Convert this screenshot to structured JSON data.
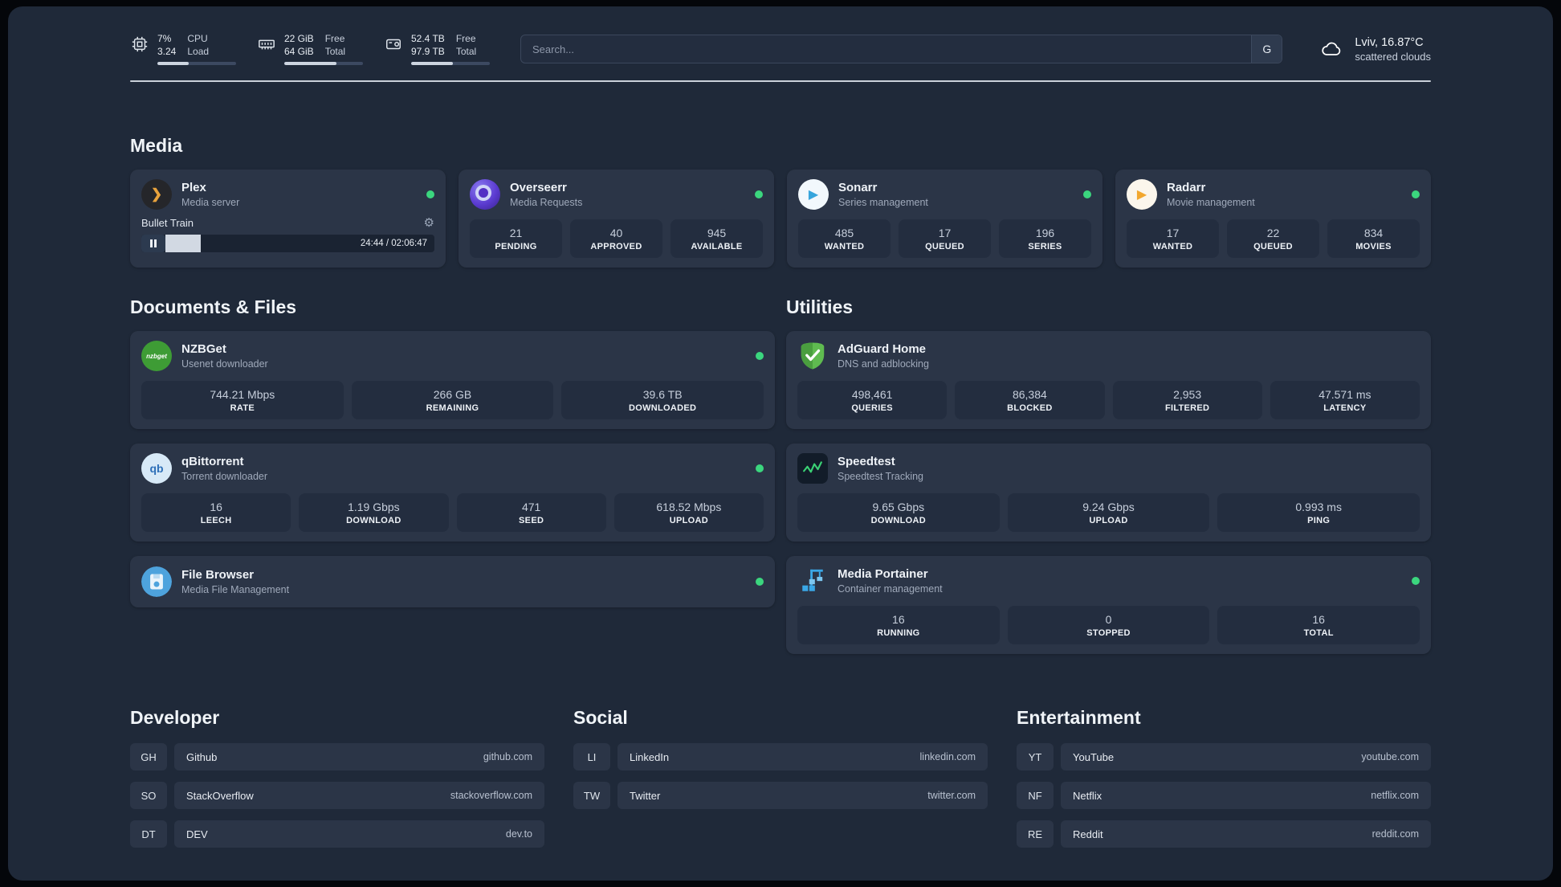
{
  "colors": {
    "status_online": "#3bd67e",
    "background": "#1f2939",
    "card": "#2b3547",
    "stat_tile": "#232d3f",
    "plex_amber": "#e8a33d",
    "overseerr_purple": "#5b3bd0",
    "sonarr_blue": "#37a5dc",
    "radarr_yellow": "#f2a72e",
    "nzbget_green": "#3e9c35",
    "adguard_green": "#5fbb50",
    "portainer_blue": "#3aa7e6"
  },
  "topbar": {
    "monitors": [
      {
        "icon": "cpu-icon",
        "line1": "7%",
        "line2": "3.24",
        "label1": "CPU",
        "label2": "Load",
        "percent": 40
      },
      {
        "icon": "memory-icon",
        "line1": "22 GiB",
        "line2": "64 GiB",
        "label1": "Free",
        "label2": "Total",
        "percent": 66
      },
      {
        "icon": "disk-icon",
        "line1": "52.4 TB",
        "line2": "97.9 TB",
        "label1": "Free",
        "label2": "Total",
        "percent": 53
      }
    ],
    "search": {
      "placeholder": "Search...",
      "engine_button": "G"
    },
    "weather": {
      "location": "Lviv, 16.87°C",
      "condition": "scattered clouds"
    }
  },
  "media": {
    "heading": "Media",
    "plex": {
      "name": "Plex",
      "subtitle": "Media server",
      "status": "online",
      "now_playing": "Bullet Train",
      "time": "24:44 / 02:06:47",
      "progress_percent": 19
    },
    "overseerr": {
      "name": "Overseerr",
      "subtitle": "Media Requests",
      "status": "online",
      "stats": [
        {
          "value": "21",
          "label": "PENDING"
        },
        {
          "value": "40",
          "label": "APPROVED"
        },
        {
          "value": "945",
          "label": "AVAILABLE"
        }
      ]
    },
    "sonarr": {
      "name": "Sonarr",
      "subtitle": "Series management",
      "status": "online",
      "stats": [
        {
          "value": "485",
          "label": "WANTED"
        },
        {
          "value": "17",
          "label": "QUEUED"
        },
        {
          "value": "196",
          "label": "SERIES"
        }
      ]
    },
    "radarr": {
      "name": "Radarr",
      "subtitle": "Movie management",
      "status": "online",
      "stats": [
        {
          "value": "17",
          "label": "WANTED"
        },
        {
          "value": "22",
          "label": "QUEUED"
        },
        {
          "value": "834",
          "label": "MOVIES"
        }
      ]
    }
  },
  "documents": {
    "heading": "Documents & Files",
    "nzbget": {
      "name": "NZBGet",
      "subtitle": "Usenet downloader",
      "status": "online",
      "icon_text": "nzbget",
      "stats": [
        {
          "value": "744.21 Mbps",
          "label": "RATE"
        },
        {
          "value": "266 GB",
          "label": "REMAINING"
        },
        {
          "value": "39.6 TB",
          "label": "DOWNLOADED"
        }
      ]
    },
    "qbittorrent": {
      "name": "qBittorrent",
      "subtitle": "Torrent downloader",
      "status": "online",
      "icon_text": "qb",
      "stats": [
        {
          "value": "16",
          "label": "LEECH"
        },
        {
          "value": "1.19 Gbps",
          "label": "DOWNLOAD"
        },
        {
          "value": "471",
          "label": "SEED"
        },
        {
          "value": "618.52 Mbps",
          "label": "UPLOAD"
        }
      ]
    },
    "filebrowser": {
      "name": "File Browser",
      "subtitle": "Media File Management",
      "status": "online"
    }
  },
  "utilities": {
    "heading": "Utilities",
    "adguard": {
      "name": "AdGuard Home",
      "subtitle": "DNS and adblocking",
      "stats": [
        {
          "value": "498,461",
          "label": "QUERIES"
        },
        {
          "value": "86,384",
          "label": "BLOCKED"
        },
        {
          "value": "2,953",
          "label": "FILTERED"
        },
        {
          "value": "47.571 ms",
          "label": "LATENCY"
        }
      ]
    },
    "speedtest": {
      "name": "Speedtest",
      "subtitle": "Speedtest Tracking",
      "stats": [
        {
          "value": "9.65 Gbps",
          "label": "DOWNLOAD"
        },
        {
          "value": "9.24 Gbps",
          "label": "UPLOAD"
        },
        {
          "value": "0.993 ms",
          "label": "PING"
        }
      ]
    },
    "portainer": {
      "name": "Media Portainer",
      "subtitle": "Container management",
      "status": "online",
      "stats": [
        {
          "value": "16",
          "label": "RUNNING"
        },
        {
          "value": "0",
          "label": "STOPPED"
        },
        {
          "value": "16",
          "label": "TOTAL"
        }
      ]
    }
  },
  "bookmarks": {
    "developer": {
      "heading": "Developer",
      "items": [
        {
          "abbr": "GH",
          "name": "Github",
          "url": "github.com"
        },
        {
          "abbr": "SO",
          "name": "StackOverflow",
          "url": "stackoverflow.com"
        },
        {
          "abbr": "DT",
          "name": "DEV",
          "url": "dev.to"
        }
      ]
    },
    "social": {
      "heading": "Social",
      "items": [
        {
          "abbr": "LI",
          "name": "LinkedIn",
          "url": "linkedin.com"
        },
        {
          "abbr": "TW",
          "name": "Twitter",
          "url": "twitter.com"
        }
      ]
    },
    "entertainment": {
      "heading": "Entertainment",
      "items": [
        {
          "abbr": "YT",
          "name": "YouTube",
          "url": "youtube.com"
        },
        {
          "abbr": "NF",
          "name": "Netflix",
          "url": "netflix.com"
        },
        {
          "abbr": "RE",
          "name": "Reddit",
          "url": "reddit.com"
        }
      ]
    }
  }
}
